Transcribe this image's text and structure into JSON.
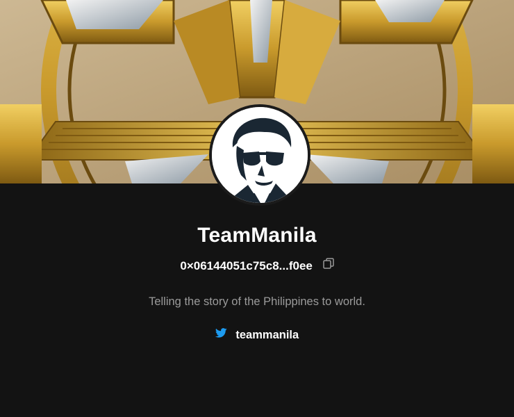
{
  "profile": {
    "name": "TeamManila",
    "address": "0×06144051c75c8...f0ee",
    "bio": "Telling the story of the Philippines to world.",
    "twitter_handle": "teammanila"
  },
  "icons": {
    "copy": "copy-icon",
    "twitter": "twitter-icon"
  },
  "colors": {
    "background": "#131313",
    "name_text": "#ffffff",
    "bio_text": "#9b9b9b",
    "twitter_blue": "#1d9bf0",
    "banner_gold": "#c9a13a"
  }
}
